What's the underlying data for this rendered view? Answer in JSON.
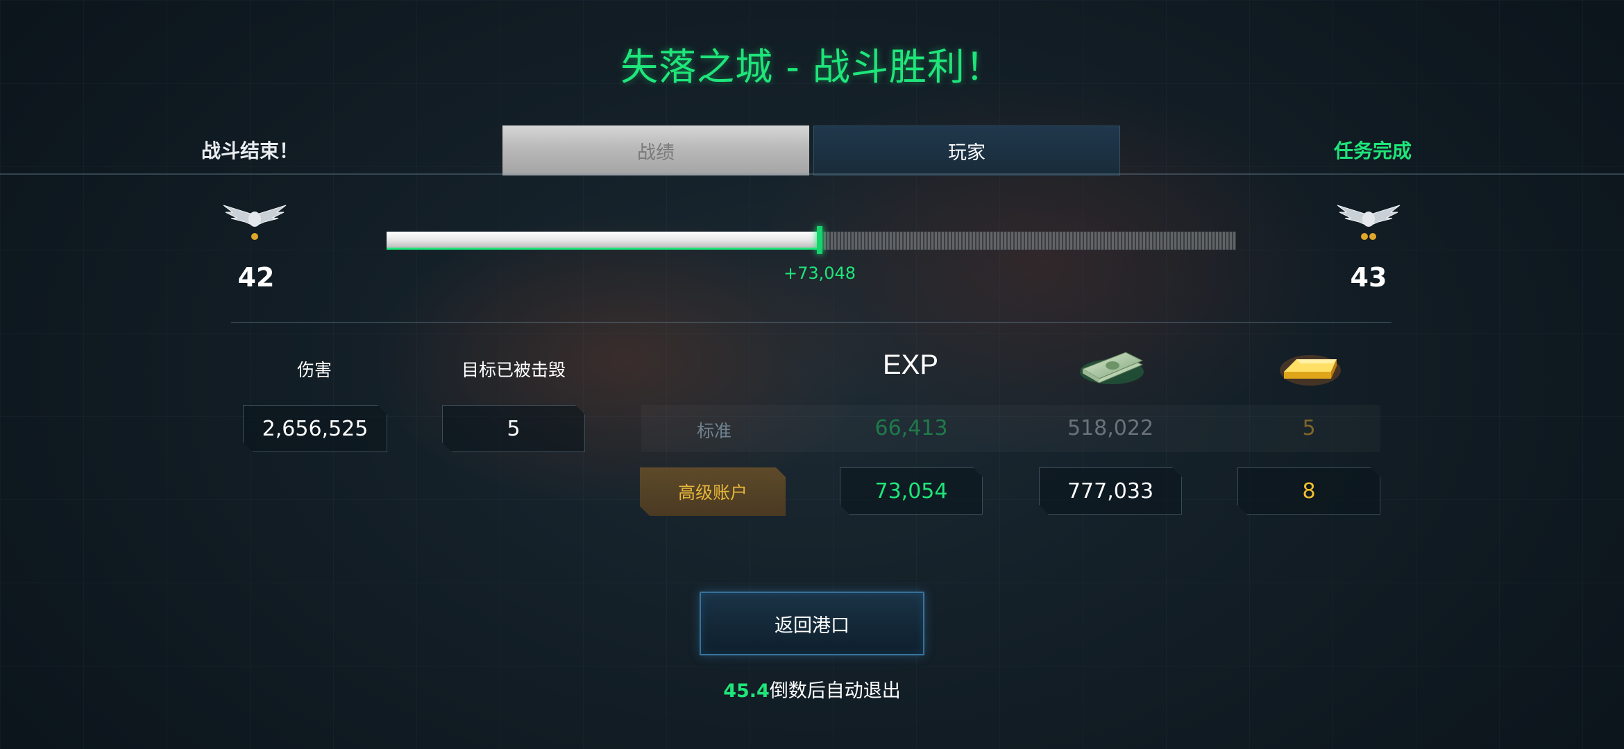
{
  "header": {
    "title": "失落之城 - 战斗胜利！",
    "battle_over": "战斗结束！",
    "mission_complete": "任务完成"
  },
  "tabs": [
    {
      "label": "战绩",
      "selected": true
    },
    {
      "label": "玩家",
      "selected": false
    }
  ],
  "progress": {
    "level_current": "42",
    "level_next": "43",
    "xp_gain": "+73,048",
    "fill_fraction": 0.51
  },
  "battle_stats": {
    "damage_label": "伤害",
    "damage_value": "2,656,525",
    "destroyed_label": "目标已被击毁",
    "destroyed_value": "5"
  },
  "rewards": {
    "exp_label": "EXP",
    "money_icon": "money-stack-icon",
    "gold_icon": "gold-bar-icon",
    "standard": {
      "label": "标准",
      "exp": "66,413",
      "money": "518,022",
      "gold": "5"
    },
    "premium": {
      "label": "高级账户",
      "exp": "73,054",
      "money": "777,033",
      "gold": "8"
    }
  },
  "actions": {
    "return_port": "返回港口"
  },
  "countdown": {
    "seconds": "45.4",
    "text": "倒数后自动退出"
  },
  "colors": {
    "accent_green": "#1ee67a",
    "gold": "#f2c02c",
    "premium_tag": "#e6b53a"
  }
}
